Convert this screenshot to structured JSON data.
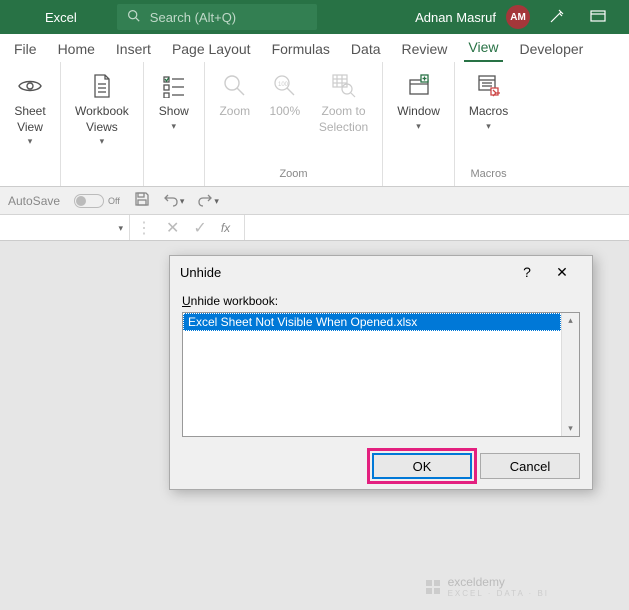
{
  "titlebar": {
    "app_name": "Excel",
    "search_placeholder": "Search (Alt+Q)",
    "user_name": "Adnan Masruf",
    "user_initials": "AM"
  },
  "tabs": [
    "File",
    "Home",
    "Insert",
    "Page Layout",
    "Formulas",
    "Data",
    "Review",
    "View",
    "Developer"
  ],
  "active_tab": "View",
  "ribbon": {
    "sheet_view": "Sheet\nView",
    "workbook_views": "Workbook\nViews",
    "show": "Show",
    "zoom": "Zoom",
    "hundred": "100%",
    "zoom_sel": "Zoom to\nSelection",
    "window": "Window",
    "macros": "Macros",
    "group_zoom": "Zoom",
    "group_macros": "Macros"
  },
  "qat": {
    "autosave": "AutoSave",
    "off": "Off"
  },
  "dialog": {
    "title": "Unhide",
    "label_prefix": "U",
    "label_rest": "nhide workbook:",
    "item": "Excel Sheet Not Visible When Opened.xlsx",
    "ok": "OK",
    "cancel": "Cancel"
  },
  "watermark": {
    "main": "exceldemy",
    "sub": "EXCEL · DATA · BI"
  }
}
